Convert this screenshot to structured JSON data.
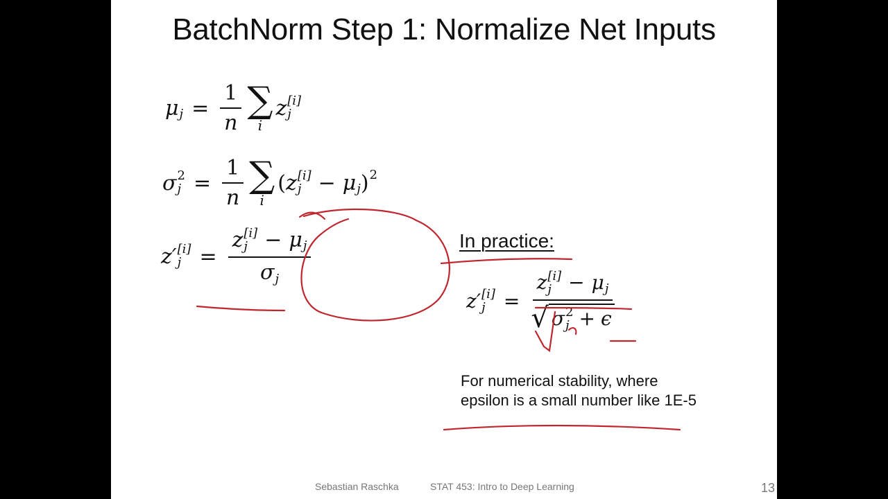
{
  "slide": {
    "title": "BatchNorm Step 1: Normalize Net Inputs",
    "eq1": {
      "lhs": "μ",
      "lhs_sub": "j",
      "eq": "=",
      "frac_num": "1",
      "frac_den": "n",
      "sum_symbol": "∑",
      "sum_index": "i",
      "term": "z",
      "term_sup": "[i]",
      "term_sub": "j"
    },
    "eq2": {
      "lhs": "σ",
      "lhs_sup": "2",
      "lhs_sub": "j",
      "eq": "=",
      "frac_num": "1",
      "frac_den": "n",
      "sum_symbol": "∑",
      "sum_index": "i",
      "open": "(",
      "term": "z",
      "term_sup": "[i]",
      "term_sub": "j",
      "minus": "−",
      "mu": "μ",
      "mu_sub": "j",
      "close": ")",
      "power": "2"
    },
    "eq3": {
      "lhs": "z′",
      "lhs_sup": "[i]",
      "lhs_sub": "j",
      "eq": "=",
      "num_term": "z",
      "num_sup": "[i]",
      "num_sub": "j",
      "minus": "−",
      "mu": "μ",
      "mu_sub": "j",
      "den": "σ",
      "den_sub": "j"
    },
    "practice": {
      "heading": "In practice:",
      "lhs": "z′",
      "lhs_sup": "[i]",
      "lhs_sub": "j",
      "eq": "=",
      "num_term": "z",
      "num_sup": "[i]",
      "num_sub": "j",
      "minus": "−",
      "mu": "μ",
      "mu_sub": "j",
      "radical": "√",
      "den_sigma": "σ",
      "den_sup": "2",
      "den_sub": "j",
      "plus": "+",
      "epsilon": "ϵ",
      "note_line1": "For numerical stability, where",
      "note_line2": "epsilon is a small number like 1E-5"
    },
    "footer": {
      "author": "Sebastian Raschka",
      "course": "STAT 453: Intro to Deep Learning",
      "page_number": "13"
    },
    "annotation_color": "#c0262d"
  }
}
